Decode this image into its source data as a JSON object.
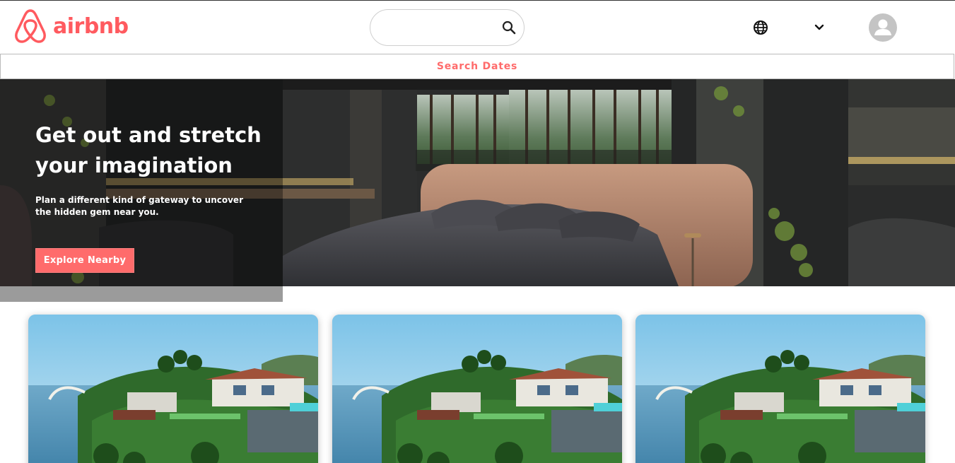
{
  "header": {
    "logo_text": "airbnb",
    "brand_color": "#ff5a5f",
    "search_placeholder": "",
    "icons": [
      "airbnb-logo-icon",
      "search-icon",
      "globe-icon",
      "chevron-down-icon",
      "user-avatar-icon"
    ]
  },
  "dates_bar": {
    "label": "Search Dates",
    "accent": "#ff6b6b"
  },
  "hero": {
    "title": "Get out and stretch your imagination",
    "subtitle": "Plan a different kind of gateway to uncover the hidden gem near you.",
    "button_label": "Explore Nearby",
    "button_color": "#ff6b6b"
  },
  "cards": [
    {
      "image": "coastal-villa-photo"
    },
    {
      "image": "coastal-villa-photo"
    },
    {
      "image": "coastal-villa-photo"
    }
  ]
}
